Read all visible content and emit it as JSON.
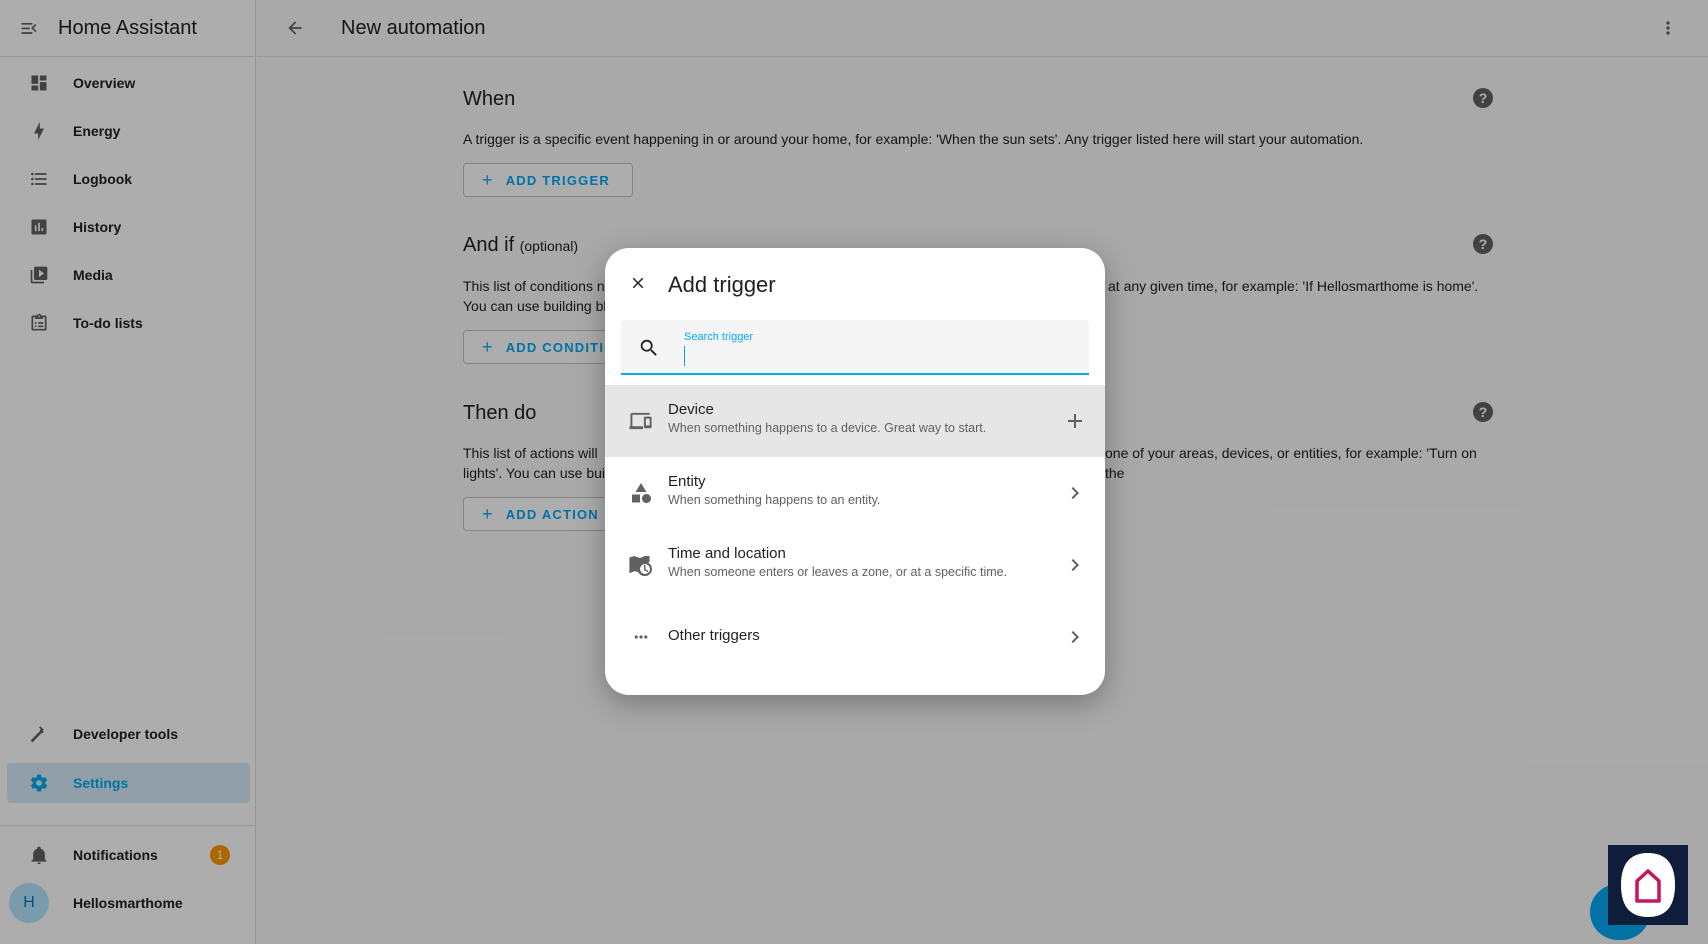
{
  "sidebar": {
    "title": "Home Assistant",
    "items": [
      {
        "label": "Overview",
        "icon": "dashboard-icon"
      },
      {
        "label": "Energy",
        "icon": "lightning-icon"
      },
      {
        "label": "Logbook",
        "icon": "list-icon"
      },
      {
        "label": "History",
        "icon": "chart-box-icon"
      },
      {
        "label": "Media",
        "icon": "play-box-icon"
      },
      {
        "label": "To-do lists",
        "icon": "clipboard-list-icon"
      }
    ],
    "bottom_items": [
      {
        "label": "Developer tools",
        "icon": "hammer-icon"
      },
      {
        "label": "Settings",
        "icon": "cog-icon",
        "active": true
      }
    ],
    "notifications": {
      "label": "Notifications",
      "count": "1"
    },
    "user": {
      "name": "Hellosmarthome",
      "initial": "H"
    }
  },
  "topbar": {
    "title": "New automation"
  },
  "sections": {
    "when": {
      "title": "When",
      "description": "A trigger is a specific event happening in or around your home, for example: 'When the sun sets'. Any trigger listed here will start your automation.",
      "button": "ADD TRIGGER"
    },
    "and_if": {
      "title": "And if",
      "optional": "(optional)",
      "desc_left": "This list of conditions n",
      "desc_right": "at any given time, for example: 'If Hellosmarthome is home'.",
      "desc_line2": "You can use building bl",
      "button": "ADD CONDITION"
    },
    "then_do": {
      "title": "Then do",
      "desc_left": "This list of actions will",
      "desc_right": "one of your areas, devices, or entities, for example: 'Turn on the",
      "desc_line2": "lights'. You can use bui",
      "button": "ADD ACTION"
    }
  },
  "dialog": {
    "title": "Add trigger",
    "search": {
      "label": "Search trigger",
      "value": ""
    },
    "items": [
      {
        "title": "Device",
        "subtitle": "When something happens to a device. Great way to start.",
        "icon": "devices-icon",
        "trailing": "plus-icon"
      },
      {
        "title": "Entity",
        "subtitle": "When something happens to an entity.",
        "icon": "shapes-icon",
        "trailing": "chevron-right-icon"
      },
      {
        "title": "Time and location",
        "subtitle": "When someone enters or leaves a zone, or at a specific time.",
        "icon": "map-clock-icon",
        "trailing": "chevron-right-icon"
      },
      {
        "title": "Other triggers",
        "subtitle": "",
        "icon": "dots-horizontal-icon",
        "trailing": "chevron-right-icon"
      }
    ]
  },
  "colors": {
    "accent": "#03a9f4",
    "badge": "#ff9800",
    "scrim": "rgba(0,0,0,0.32)",
    "logo_bg": "#0e1d3a",
    "logo_accent": "#c2185b"
  }
}
